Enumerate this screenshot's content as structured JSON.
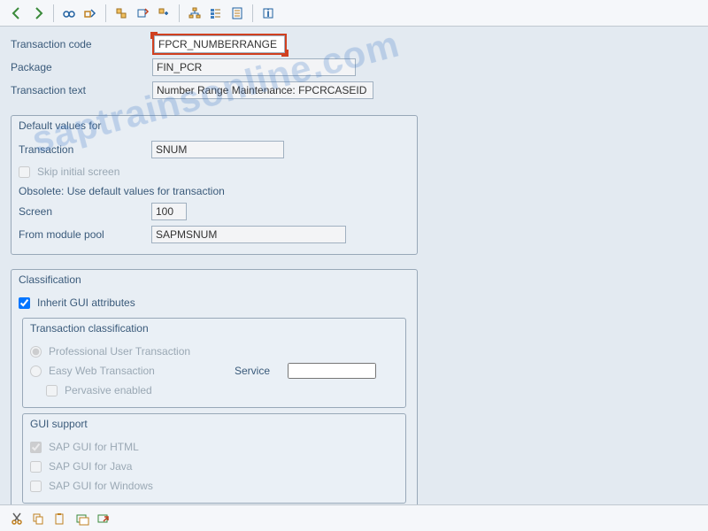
{
  "watermark": "saptrainsonline.com",
  "fields": {
    "transaction_code": {
      "label": "Transaction code",
      "value": "FPCR_NUMBERRANGE"
    },
    "package": {
      "label": "Package",
      "value": "FIN_PCR"
    },
    "transaction_text": {
      "label": "Transaction text",
      "value": "Number Range Maintenance: FPCRCASEID"
    }
  },
  "default_values": {
    "title": "Default values for",
    "transaction": {
      "label": "Transaction",
      "value": "SNUM"
    },
    "skip_initial": {
      "label": "Skip initial screen",
      "checked": false
    },
    "obsolete_note": "Obsolete: Use default values for transaction",
    "screen": {
      "label": "Screen",
      "value": "100"
    },
    "from_module_pool": {
      "label": "From module pool",
      "value": "SAPMSNUM"
    }
  },
  "classification": {
    "title": "Classification",
    "inherit": {
      "label": "Inherit GUI attributes",
      "checked": true
    },
    "trans_class": {
      "title": "Transaction classification",
      "professional": {
        "label": "Professional User Transaction",
        "selected": true
      },
      "easy_web": {
        "label": "Easy Web Transaction",
        "selected": false
      },
      "service_label": "Service",
      "service_value": "",
      "pervasive": {
        "label": "Pervasive enabled",
        "checked": false
      }
    },
    "gui_support": {
      "title": "GUI support",
      "html": {
        "label": "SAP GUI for HTML",
        "checked": true
      },
      "java": {
        "label": "SAP GUI for Java",
        "checked": false
      },
      "windows": {
        "label": "SAP GUI for Windows",
        "checked": false
      }
    }
  }
}
